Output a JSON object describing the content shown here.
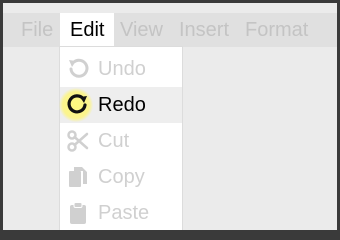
{
  "menubar": {
    "items": [
      {
        "label": "File",
        "active": false
      },
      {
        "label": "Edit",
        "active": true
      },
      {
        "label": "View",
        "active": false
      },
      {
        "label": "Insert",
        "active": false
      },
      {
        "label": "Format",
        "active": false
      }
    ]
  },
  "edit_menu": {
    "items": [
      {
        "label": "Undo",
        "icon": "undo-icon",
        "enabled": false
      },
      {
        "label": "Redo",
        "icon": "redo-icon",
        "enabled": true,
        "hovered": true
      },
      {
        "label": "Cut",
        "icon": "scissors-icon",
        "enabled": false
      },
      {
        "label": "Copy",
        "icon": "copy-icon",
        "enabled": false
      },
      {
        "label": "Paste",
        "icon": "clipboard-icon",
        "enabled": false
      }
    ]
  },
  "colors": {
    "desktop_frame": "#3a3a3a",
    "menubar_bg": "#e0e0e0",
    "disabled_text": "#c4c4c4",
    "hover_bg": "#eeeeee",
    "cursor_highlight": "#fff676"
  }
}
